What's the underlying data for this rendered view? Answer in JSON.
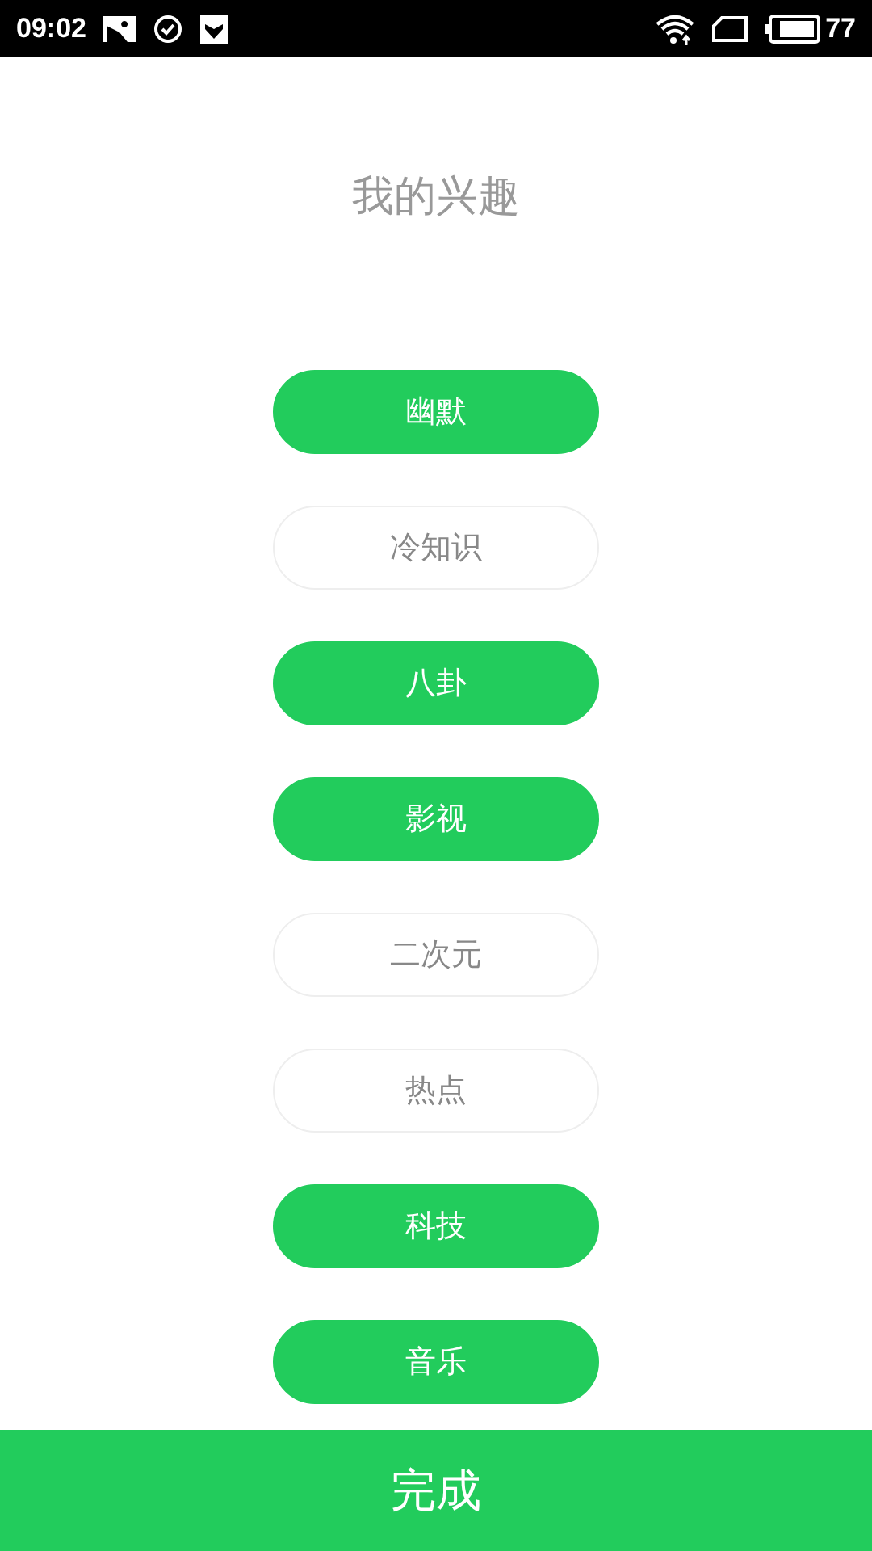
{
  "status_bar": {
    "time": "09:02",
    "battery": "77"
  },
  "title": "我的兴趣",
  "interests": [
    {
      "label": "幽默",
      "selected": true
    },
    {
      "label": "冷知识",
      "selected": false
    },
    {
      "label": "八卦",
      "selected": true
    },
    {
      "label": "影视",
      "selected": true
    },
    {
      "label": "二次元",
      "selected": false
    },
    {
      "label": "热点",
      "selected": false
    },
    {
      "label": "科技",
      "selected": true
    },
    {
      "label": "音乐",
      "selected": true
    }
  ],
  "done_button": "完成"
}
